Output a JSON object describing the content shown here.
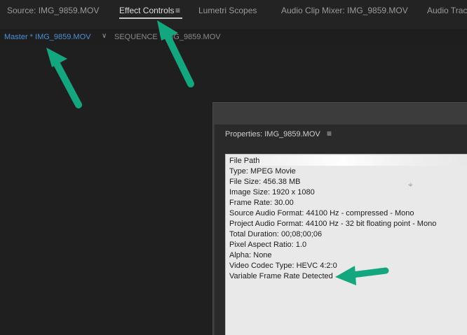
{
  "tabs": [
    {
      "label": "Source: IMG_9859.MOV",
      "active": false
    },
    {
      "label": "Effect Controls",
      "active": true
    },
    {
      "label": "Lumetri Scopes",
      "active": false
    },
    {
      "label": "Audio Clip Mixer: IMG_9859.MOV",
      "active": false
    },
    {
      "label": "Audio Track",
      "active": false
    }
  ],
  "tab_menu_icon": "hamburger-menu-icon",
  "subbar": {
    "master_label": "Master * IMG_9859.MOV",
    "chevron_icon": "chevron-down-icon",
    "sequence_label": "SEQUENCE * IMG_9859.MOV"
  },
  "dialog": {
    "title": "Properties: IMG_9859.MOV",
    "menu_icon": "hamburger-menu-icon",
    "properties": [
      "File Path",
      "Type: MPEG Movie",
      "File Size: 456.38 MB",
      "Image Size: 1920 x 1080",
      "Frame Rate: 30.00",
      "Source Audio Format: 44100 Hz - compressed - Mono",
      "Project Audio Format: 44100 Hz - 32 bit floating point - Mono",
      "Total Duration: 00;08;00;06",
      "Pixel Aspect Ratio: 1.0",
      "Alpha: None",
      "Video Codec Type: HEVC 4:2:0",
      "Variable Frame Rate Detected"
    ]
  },
  "colors": {
    "annotation_arrow": "#14a67e",
    "active_clip_link": "#4e8fd6",
    "background": "#232323"
  }
}
